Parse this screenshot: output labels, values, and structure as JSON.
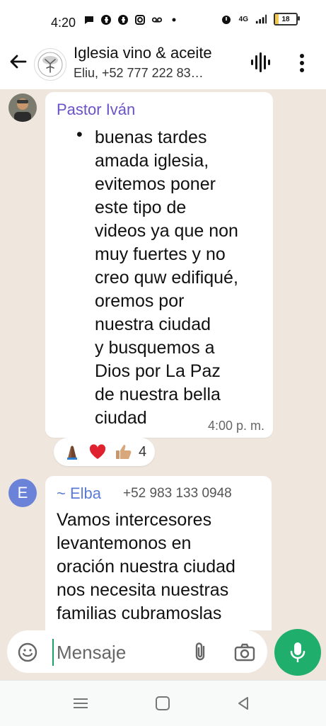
{
  "status": {
    "time": "4:20",
    "network": "4G",
    "battery_level": "18",
    "battery_fraction": 0.18
  },
  "header": {
    "title": "Iglesia vino & aceite",
    "subtitle": "Eliu, +52 777 222 83…"
  },
  "messages": [
    {
      "sender": "Pastor Iván",
      "bullet": "•",
      "text": "buenas tardes\namada iglesia,\nevitemos poner\neste tipo de\nvideos ya que non\nmuy fuertes y no\ncreo quw edifiqué,\noremos por\nnuestra ciudad\ny busquemos a\nDios por La Paz\nde nuestra bella\nciudad",
      "time": "4:00 p. m.",
      "reaction_count": "4"
    },
    {
      "avatar_initial": "E",
      "sender": "~ Elba",
      "phone": "+52 983 133 0948",
      "text": "Vamos intercesores\nlevantemonos  en\noración nuestra ciudad\nnos necesita nuestras\nfamilias cubramoslas"
    }
  ],
  "input": {
    "placeholder": "Mensaje"
  },
  "colors": {
    "accent": "#1fae6c",
    "sender_purple": "#6b52c6",
    "chat_bg": "#efe7de"
  },
  "icons": {
    "back": "arrow-left-icon",
    "voice": "voice-waveform-icon",
    "more": "more-vert-icon",
    "emoji": "emoji-icon",
    "attach": "paperclip-icon",
    "camera": "camera-icon",
    "mic": "microphone-icon"
  }
}
